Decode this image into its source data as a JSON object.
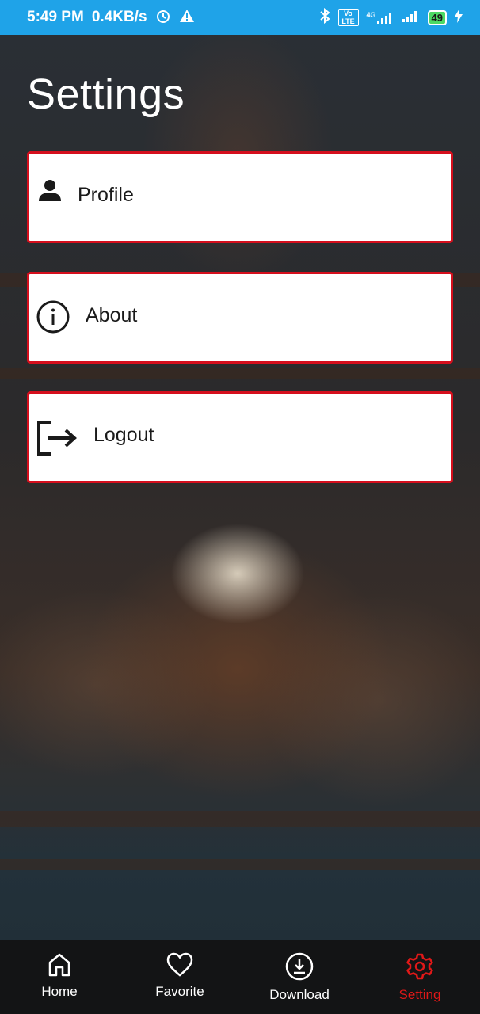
{
  "status_bar": {
    "time": "5:49 PM",
    "net_speed": "0.4KB/s",
    "alarm_icon": "alarm-icon",
    "warning_icon": "warning-icon",
    "bluetooth_icon": "bluetooth-icon",
    "volte_label": "Vo LTE",
    "signal_4g_label": "4G",
    "battery_level": "49"
  },
  "page": {
    "title": "Settings"
  },
  "menu": {
    "items": [
      {
        "label": "Profile",
        "icon": "person-icon"
      },
      {
        "label": "About",
        "icon": "info-icon"
      },
      {
        "label": "Logout",
        "icon": "logout-icon"
      }
    ],
    "border_color": "#d50f1d"
  },
  "bottom_nav": {
    "items": [
      {
        "label": "Home",
        "icon": "home-icon"
      },
      {
        "label": "Favorite",
        "icon": "heart-icon"
      },
      {
        "label": "Download",
        "icon": "download-icon"
      },
      {
        "label": "Setting",
        "icon": "gear-icon"
      }
    ],
    "active": "Setting",
    "active_color": "#e01818",
    "inactive_color": "#ffffff"
  },
  "colors": {
    "status_bar": "#1fa3e8"
  }
}
